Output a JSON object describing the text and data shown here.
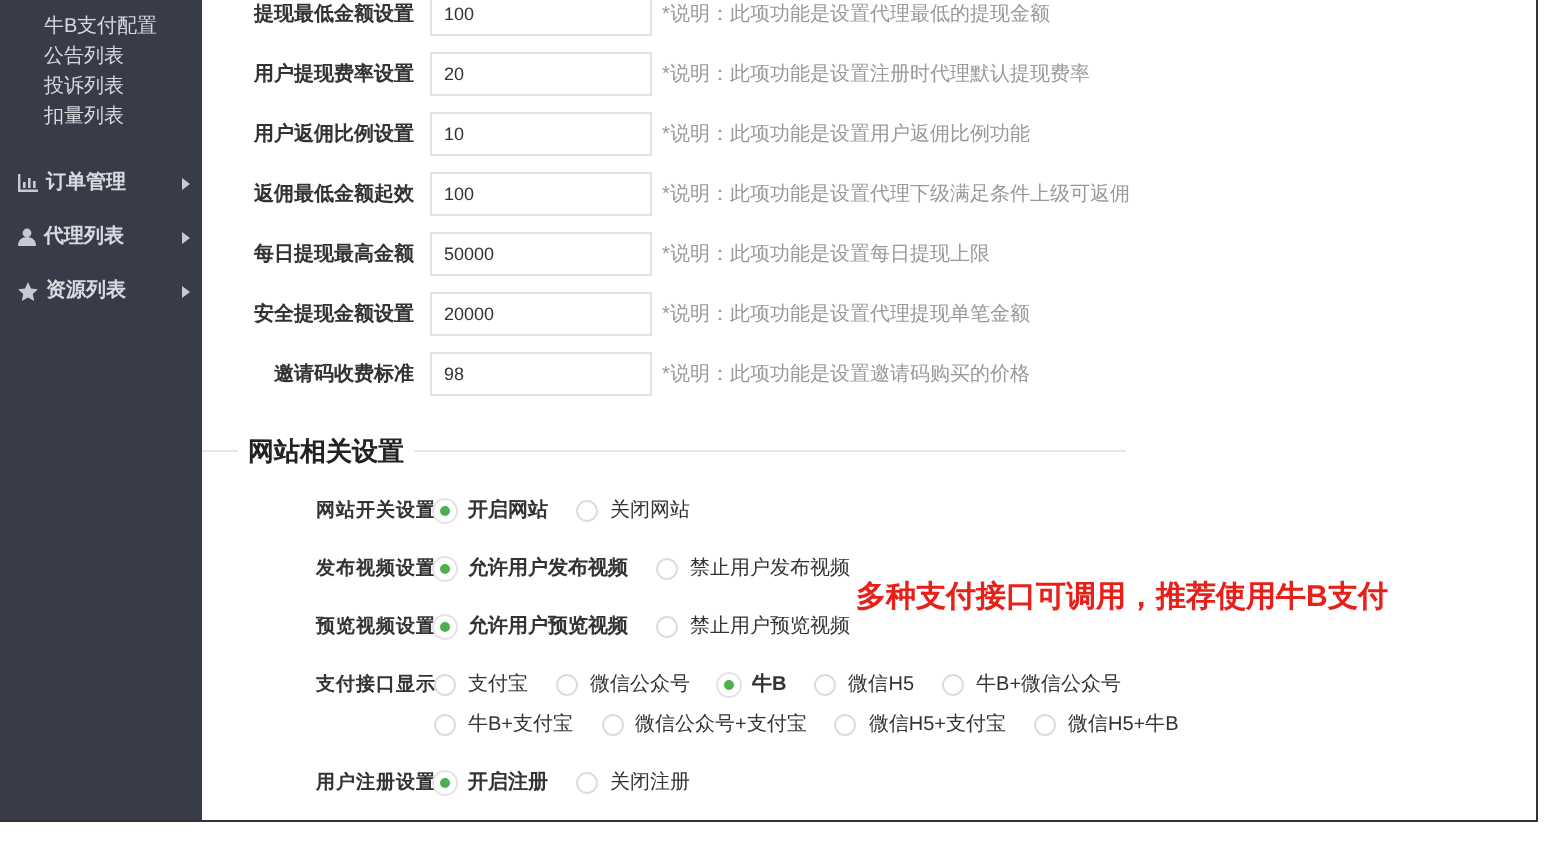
{
  "sidebar": {
    "sub_items": [
      {
        "label": "牛B支付配置"
      },
      {
        "label": "公告列表"
      },
      {
        "label": "投诉列表"
      },
      {
        "label": "扣量列表"
      }
    ],
    "groups": [
      {
        "label": "订单管理"
      },
      {
        "label": "代理列表"
      },
      {
        "label": "资源列表"
      }
    ]
  },
  "settings": [
    {
      "label": "提现最低金额设置",
      "value": "100",
      "note": "*说明：此项功能是设置代理最低的提现金额"
    },
    {
      "label": "用户提现费率设置",
      "value": "20",
      "note": "*说明：此项功能是设置注册时代理默认提现费率"
    },
    {
      "label": "用户返佣比例设置",
      "value": "10",
      "note": "*说明：此项功能是设置用户返佣比例功能"
    },
    {
      "label": "返佣最低金额起效",
      "value": "100",
      "note": "*说明：此项功能是设置代理下级满足条件上级可返佣"
    },
    {
      "label": "每日提现最高金额",
      "value": "50000",
      "note": "*说明：此项功能是设置每日提现上限"
    },
    {
      "label": "安全提现金额设置",
      "value": "20000",
      "note": "*说明：此项功能是设置代理提现单笔金额"
    },
    {
      "label": "邀请码收费标准",
      "value": "98",
      "note": "*说明：此项功能是设置邀请码购买的价格"
    }
  ],
  "section_title": "网站相关设置",
  "radio_settings": [
    {
      "label": "网站开关设置",
      "option_rows": [
        [
          {
            "label": "开启网站",
            "selected": true
          },
          {
            "label": "关闭网站",
            "selected": false
          }
        ]
      ]
    },
    {
      "label": "发布视频设置",
      "option_rows": [
        [
          {
            "label": "允许用户发布视频",
            "selected": true
          },
          {
            "label": "禁止用户发布视频",
            "selected": false
          }
        ]
      ]
    },
    {
      "label": "预览视频设置",
      "option_rows": [
        [
          {
            "label": "允许用户预览视频",
            "selected": true
          },
          {
            "label": "禁止用户预览视频",
            "selected": false
          }
        ]
      ]
    },
    {
      "label": "支付接口显示",
      "option_rows": [
        [
          {
            "label": "支付宝",
            "selected": false
          },
          {
            "label": "微信公众号",
            "selected": false
          },
          {
            "label": "牛B",
            "selected": true
          },
          {
            "label": "微信H5",
            "selected": false
          },
          {
            "label": "牛B+微信公众号",
            "selected": false
          }
        ],
        [
          {
            "label": "牛B+支付宝",
            "selected": false
          },
          {
            "label": "微信公众号+支付宝",
            "selected": false
          },
          {
            "label": "微信H5+支付宝",
            "selected": false
          },
          {
            "label": "微信H5+牛B",
            "selected": false
          }
        ]
      ]
    },
    {
      "label": "用户注册设置",
      "option_rows": [
        [
          {
            "label": "开启注册",
            "selected": true
          },
          {
            "label": "关闭注册",
            "selected": false
          }
        ]
      ]
    }
  ],
  "promo_text": "多种支付接口可调用，推荐使用牛B支付"
}
